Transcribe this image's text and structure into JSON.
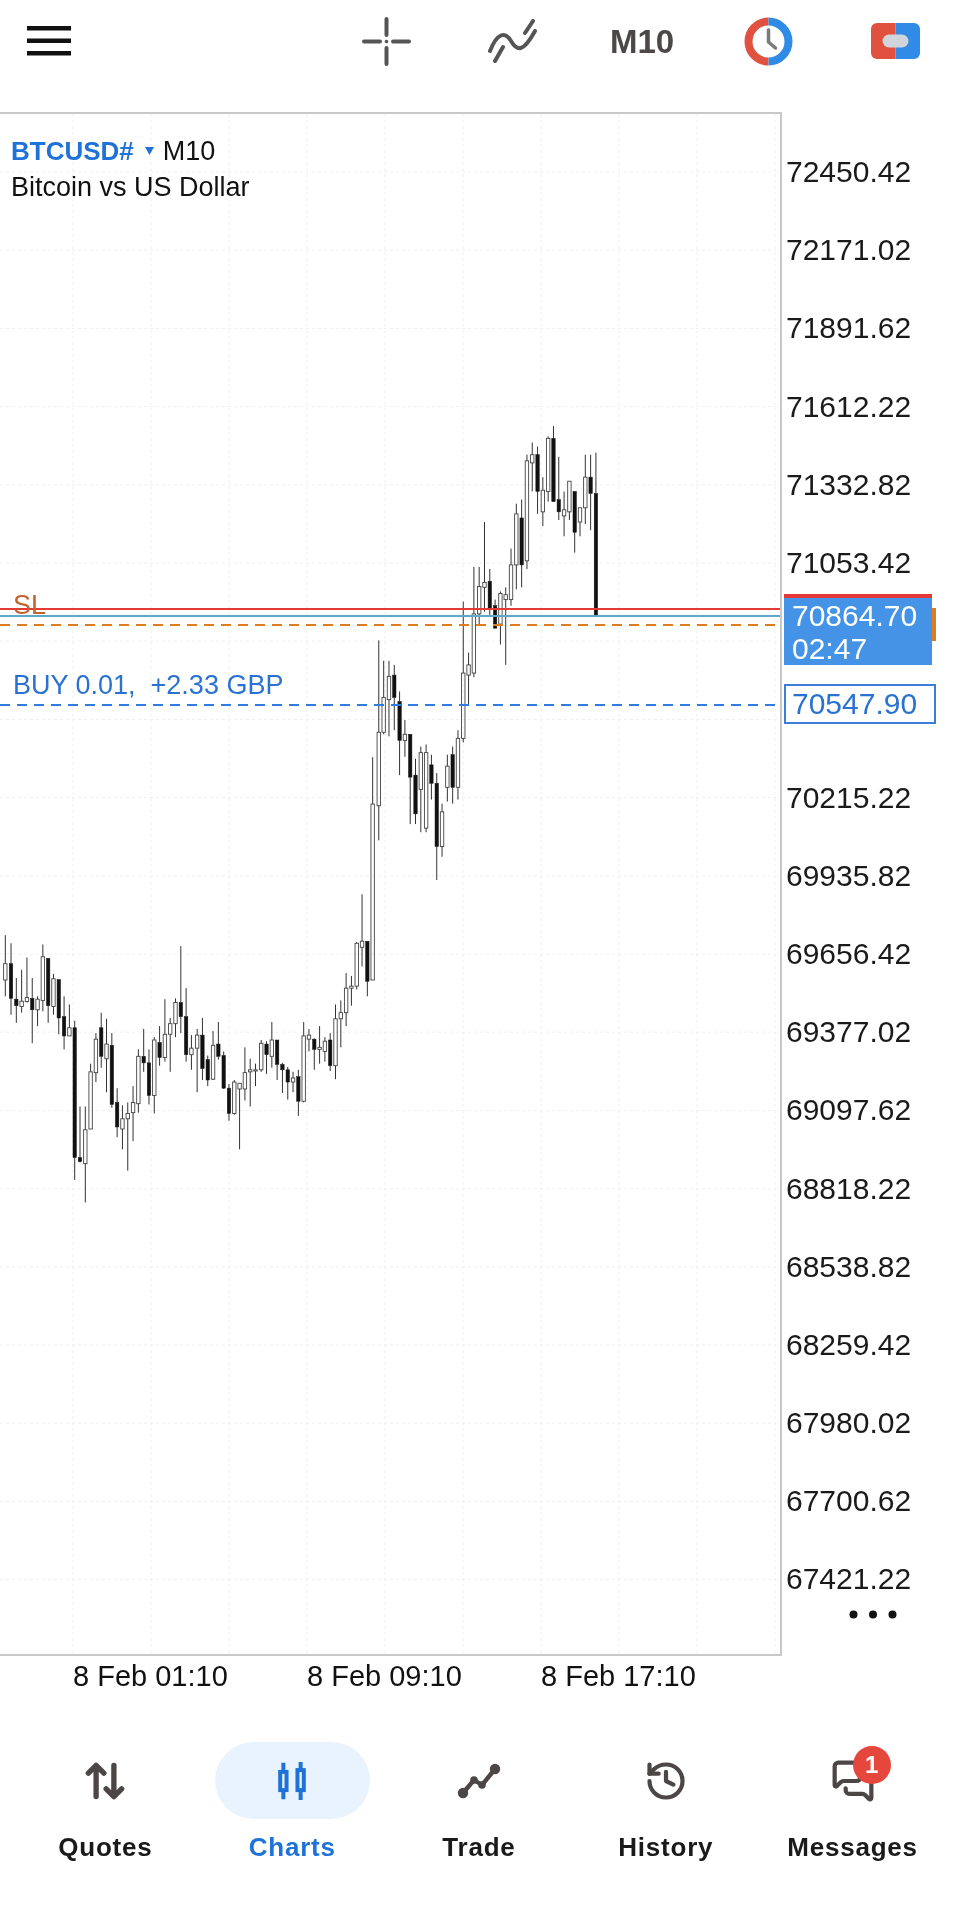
{
  "toolbar": {
    "timeframe": "M10"
  },
  "chart": {
    "symbol": "BTCUSD#",
    "timeframe": "M10",
    "description": "Bitcoin vs US Dollar",
    "stop_loss_label": "SL",
    "position_label": "BUY 0.01,  +2.33 GBP"
  },
  "price_axis": {
    "upper_labels": [
      "72450.42",
      "72171.02",
      "71891.62",
      "71612.22",
      "71332.82",
      "71053.42"
    ],
    "bid_price": "70864.70",
    "countdown": "02:47",
    "position_price": "70547.90",
    "lower_labels": [
      "70215.22",
      "69935.82",
      "69656.42",
      "69377.02",
      "69097.62",
      "68818.22",
      "68538.82",
      "68259.42",
      "67980.02",
      "67700.62",
      "67421.22"
    ]
  },
  "time_axis": [
    "8 Feb 01:10",
    "8 Feb 09:10",
    "8 Feb 17:10"
  ],
  "bottom_nav": [
    {
      "label": "Quotes",
      "selected": false
    },
    {
      "label": "Charts",
      "selected": true
    },
    {
      "label": "Trade",
      "selected": false
    },
    {
      "label": "History",
      "selected": false
    },
    {
      "label": "Messages",
      "selected": false,
      "badge": "1"
    }
  ]
}
